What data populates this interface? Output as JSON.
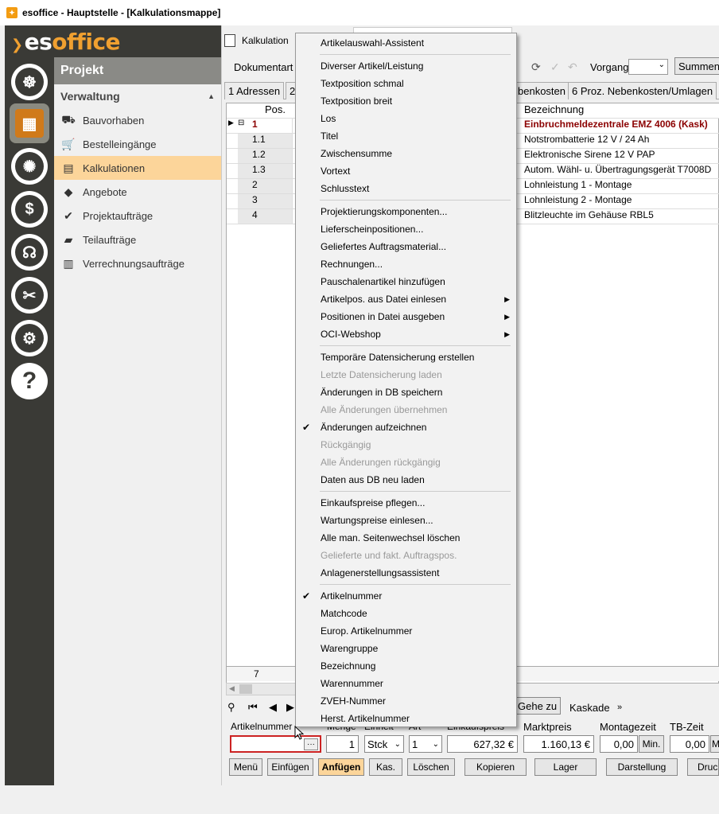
{
  "window": {
    "title": "esoffice - Hauptstelle - [Kalkulationsmappe]"
  },
  "logo": {
    "prefix": "es",
    "suffix": "office"
  },
  "rail_icons": [
    "helm-icon",
    "document-grid-icon",
    "alarm-light-icon",
    "money-icon",
    "headset-icon",
    "tools-icon",
    "gears-icon",
    "help-icon"
  ],
  "nav": {
    "header": "Projekt",
    "section": "Verwaltung",
    "items": [
      {
        "label": "Bauvorhaben",
        "icon": "excavator-icon"
      },
      {
        "label": "Bestelleingänge",
        "icon": "cart-icon"
      },
      {
        "label": "Kalkulationen",
        "icon": "calculation-icon"
      },
      {
        "label": "Angebote",
        "icon": "tag-icon"
      },
      {
        "label": "Projektaufträge",
        "icon": "check-circle-icon"
      },
      {
        "label": "Teilaufträge",
        "icon": "partial-order-icon"
      },
      {
        "label": "Verrechnungsaufträge",
        "icon": "billing-icon"
      }
    ]
  },
  "doc_tab": {
    "label": "Kalkulation"
  },
  "toolbar": {
    "doc_type": "Dokumentart",
    "vorgang": "Vorgang",
    "summen": "Summen"
  },
  "tabs": [
    "1 Adressen",
    "2",
    "benkosten",
    "6 Proz. Nebenkosten/Umlagen"
  ],
  "grid": {
    "col_pos": "Pos.",
    "col_bez": "Bezeichnung",
    "rows": [
      {
        "pos": "1",
        "bez": "Einbruchmeldezentrale EMZ 4006 (Kask)"
      },
      {
        "pos": "1.1",
        "bez": "Notstrombatterie 12 V / 24 Ah"
      },
      {
        "pos": "1.2",
        "bez": "Elektronische Sirene 12 V PAP"
      },
      {
        "pos": "1.3",
        "bez": "Autom. Wähl- u. Übertragungsgerät T7008D"
      },
      {
        "pos": "2",
        "bez": "Lohnleistung 1 - Montage"
      },
      {
        "pos": "3",
        "bez": "Lohnleistung 2 - Montage"
      },
      {
        "pos": "4",
        "bez": "Blitzleuchte im Gehäuse RBL5"
      }
    ],
    "count": "7"
  },
  "bottom_nav": {
    "gehe_zu": "Gehe zu",
    "kaskade": "Kaskade"
  },
  "fields": {
    "artikelnummer_label": "Artikelnummer",
    "menge_label": "Menge",
    "einheit_label": "Einheit",
    "art_label": "Art",
    "ek_label": "Einkaufspreis",
    "marktpreis_label": "Marktpreis",
    "montagezeit_label": "Montagezeit",
    "tbzeit_label": "TB-Zeit",
    "menge": "1",
    "einheit": "Stck",
    "art": "1",
    "ek": "627,32 €",
    "marktpreis": "1.160,13 €",
    "montagezeit": "0,00",
    "min": "Min.",
    "tbzeit": "0,00",
    "m": "M"
  },
  "buttons": {
    "menu": "Menü",
    "einfuegen": "Einfügen",
    "anfuegen": "Anfügen",
    "kas": "Kas.",
    "loeschen": "Löschen",
    "kopieren": "Kopieren",
    "lager": "Lager",
    "darstellung": "Darstellung",
    "druck": "Druc"
  },
  "context_menu": {
    "items": [
      {
        "label": "Artikelauswahl-Assistent",
        "state": "enabled"
      },
      {
        "sep": true
      },
      {
        "label": "Diverser Artikel/Leistung",
        "state": "enabled"
      },
      {
        "label": "Textposition schmal",
        "state": "enabled"
      },
      {
        "label": "Textposition breit",
        "state": "enabled"
      },
      {
        "label": "Los",
        "state": "enabled"
      },
      {
        "label": "Titel",
        "state": "enabled"
      },
      {
        "label": "Zwischensumme",
        "state": "enabled"
      },
      {
        "label": "Vortext",
        "state": "enabled"
      },
      {
        "label": "Schlusstext",
        "state": "enabled"
      },
      {
        "sep": true
      },
      {
        "label": "Projektierungskomponenten...",
        "state": "enabled"
      },
      {
        "label": "Lieferscheinpositionen...",
        "state": "enabled"
      },
      {
        "label": "Geliefertes Auftragsmaterial...",
        "state": "enabled"
      },
      {
        "label": "Rechnungen...",
        "state": "enabled"
      },
      {
        "label": "Pauschalenartikel hinzufügen",
        "state": "enabled"
      },
      {
        "label": "Artikelpos. aus Datei einlesen",
        "state": "enabled",
        "submenu": true
      },
      {
        "label": "Positionen in Datei ausgeben",
        "state": "enabled",
        "submenu": true
      },
      {
        "label": "OCI-Webshop",
        "state": "enabled",
        "submenu": true
      },
      {
        "sep": true
      },
      {
        "label": "Temporäre Datensicherung erstellen",
        "state": "enabled"
      },
      {
        "label": "Letzte Datensicherung laden",
        "state": "disabled"
      },
      {
        "label": "Änderungen in DB speichern",
        "state": "enabled"
      },
      {
        "label": "Alle Änderungen übernehmen",
        "state": "disabled"
      },
      {
        "label": "Änderungen aufzeichnen",
        "state": "enabled",
        "checked": true
      },
      {
        "label": "Rückgängig",
        "state": "disabled"
      },
      {
        "label": "Alle Änderungen rückgängig",
        "state": "disabled"
      },
      {
        "label": "Daten aus DB neu laden",
        "state": "enabled"
      },
      {
        "sep": true
      },
      {
        "label": "Einkaufspreise pflegen...",
        "state": "enabled"
      },
      {
        "label": "Wartungspreise einlesen...",
        "state": "enabled"
      },
      {
        "label": "Alle man. Seitenwechsel löschen",
        "state": "enabled"
      },
      {
        "label": "Gelieferte und fakt. Auftragspos.",
        "state": "disabled"
      },
      {
        "label": "Anlagenerstellungsassistent",
        "state": "enabled"
      },
      {
        "sep": true
      },
      {
        "label": "Artikelnummer",
        "state": "enabled",
        "checked": true
      },
      {
        "label": "Matchcode",
        "state": "enabled"
      },
      {
        "label": "Europ. Artikelnummer",
        "state": "enabled"
      },
      {
        "label": "Warengruppe",
        "state": "enabled"
      },
      {
        "label": "Bezeichnung",
        "state": "enabled"
      },
      {
        "label": "Warennummer",
        "state": "enabled"
      },
      {
        "label": "ZVEH-Nummer",
        "state": "enabled"
      },
      {
        "label": "Herst. Artikelnummer",
        "state": "enabled"
      }
    ]
  },
  "colors": {
    "accent": "#f0a030",
    "selected_nav": "#fcd59a",
    "rail": "#3a3a36",
    "kask_text": "#8b0000",
    "error_border": "#cc2222"
  }
}
